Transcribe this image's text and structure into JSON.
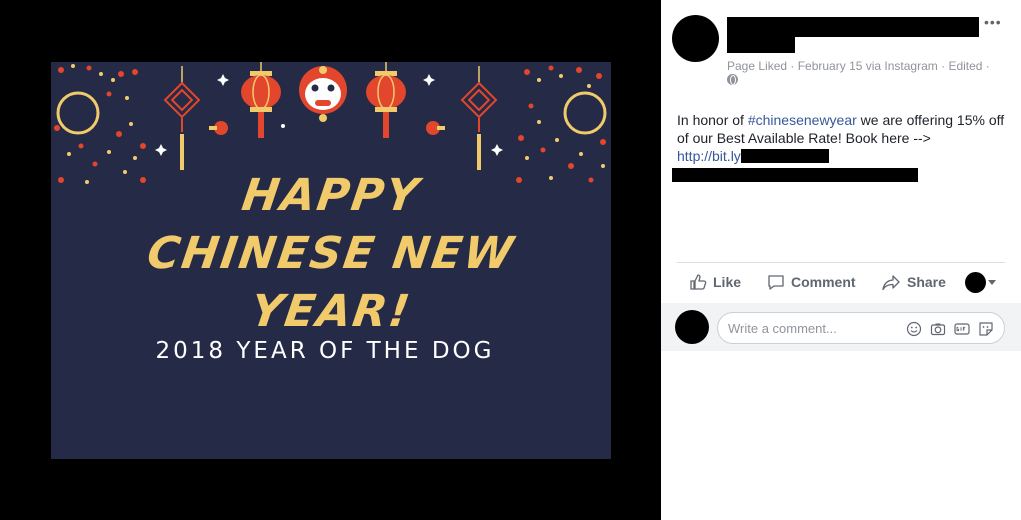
{
  "photo": {
    "line1": "HAPPY",
    "line2": "CHINESE NEW",
    "line3": "YEAR!",
    "subtitle": "2018 YEAR OF THE DOG"
  },
  "post": {
    "more_label": "•••",
    "meta": "Page Liked · February 15 via Instagram · Edited ·",
    "text_prefix": "In honor of ",
    "hashtag": "#chinesenewyear",
    "text_suffix": " we are offering 15% off of our Best Available Rate! Book here -->",
    "link_prefix": "http://bit.ly"
  },
  "actions": {
    "like_label": "Like",
    "comment_label": "Comment",
    "share_label": "Share"
  },
  "comment": {
    "placeholder": "Write a comment..."
  },
  "colors": {
    "photo_bg": "#252a46",
    "title_gold": "#f1cb6b",
    "lantern_red": "#e2462c",
    "link_blue": "#365899"
  },
  "icons": [
    "more-icon",
    "globe-icon",
    "like-icon",
    "comment-icon",
    "share-icon",
    "caret-down-icon",
    "emoji-icon",
    "camera-icon",
    "gif-icon",
    "sticker-icon"
  ]
}
